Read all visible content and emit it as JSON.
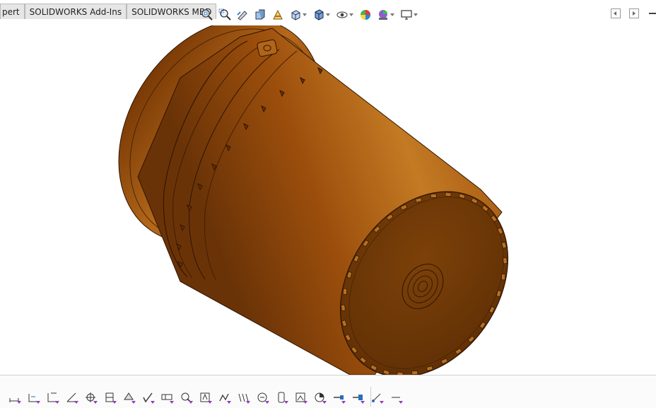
{
  "tabs": [
    {
      "label": "pert"
    },
    {
      "label": "SOLIDWORKS Add-Ins"
    },
    {
      "label": "SOLIDWORKS MBD"
    }
  ],
  "headsup_icons": [
    "zoom-to-fit-icon",
    "zoom-to-area-icon",
    "previous-view-icon",
    "section-view-icon",
    "dynamic-annotation-icon",
    "view-orientation-icon",
    "display-style-icon",
    "hide-show-items-icon",
    "edit-appearance-icon",
    "apply-scene-icon",
    "view-settings-icon"
  ],
  "bottom_tools": [
    "smart-dimension-icon",
    "dimension-chain-icon",
    "ordinate-dimension-icon",
    "angle-dimension-icon",
    "datum-feature-icon",
    "datum-target-icon",
    "geometric-tolerance-icon",
    "surface-finish-icon",
    "weld-symbol-icon",
    "hole-callout-icon",
    "note-icon",
    "balloon-icon",
    "spring-icon",
    "cosmetic-thread-icon",
    "weld-bead-icon",
    "center-mark-icon",
    "block-icon",
    "area-hatch-icon",
    "annotation-view-icon",
    "pin-icon",
    "link-icon"
  ],
  "colors": {
    "body": "#a2550f",
    "body_highlight": "#c37a23",
    "body_shadow": "#6a3307",
    "end_face": "#733a08",
    "edges": "#2e1402",
    "tool_accent": "#8e3fb5"
  }
}
